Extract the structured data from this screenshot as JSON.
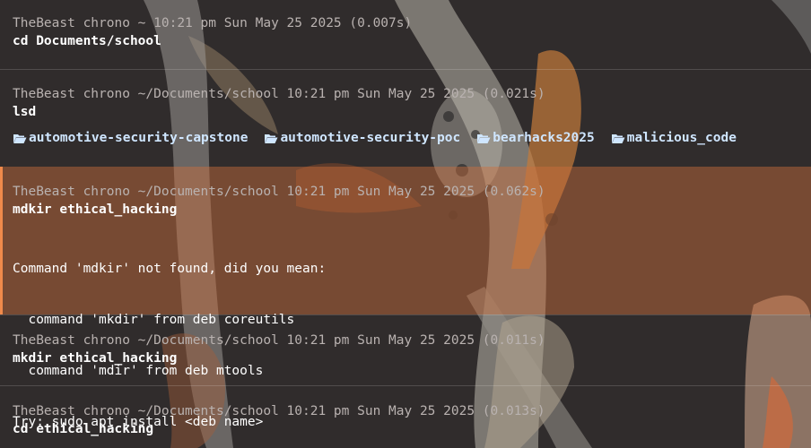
{
  "blocks": [
    {
      "header": "TheBeast chrono ~ 10:21 pm Sun May 25 2025 (0.007s)",
      "command": "cd Documents/school"
    },
    {
      "header": "TheBeast chrono ~/Documents/school 10:21 pm Sun May 25 2025 (0.021s)",
      "command": "lsd",
      "listing": [
        "automotive-security-capstone",
        "automotive-security-poc",
        "bearhacks2025",
        "malicious_code"
      ]
    },
    {
      "header": "TheBeast chrono ~/Documents/school 10:21 pm Sun May 25 2025 (0.062s)",
      "command": "mdkir ethical_hacking",
      "output": [
        "Command 'mdkir' not found, did you mean:",
        "  command 'mkdir' from deb coreutils",
        "  command 'mdir' from deb mtools",
        "Try: sudo apt install <deb name>"
      ]
    },
    {
      "header": "TheBeast chrono ~/Documents/school 10:21 pm Sun May 25 2025 (0.011s)",
      "command": "mkdir ethical_hacking"
    },
    {
      "header": "TheBeast chrono ~/Documents/school 10:21 pm Sun May 25 2025 (0.013s)",
      "command": "cd ethical_hacking"
    }
  ],
  "icons": {
    "listing_icon": "folder-open-icon"
  },
  "colors": {
    "background": "#2e2b2c",
    "header_text": "#b9b2b0",
    "error_block_bg": "#8a5a42",
    "error_accent": "#f08a4b",
    "folder_text": "#cfe6ff"
  }
}
